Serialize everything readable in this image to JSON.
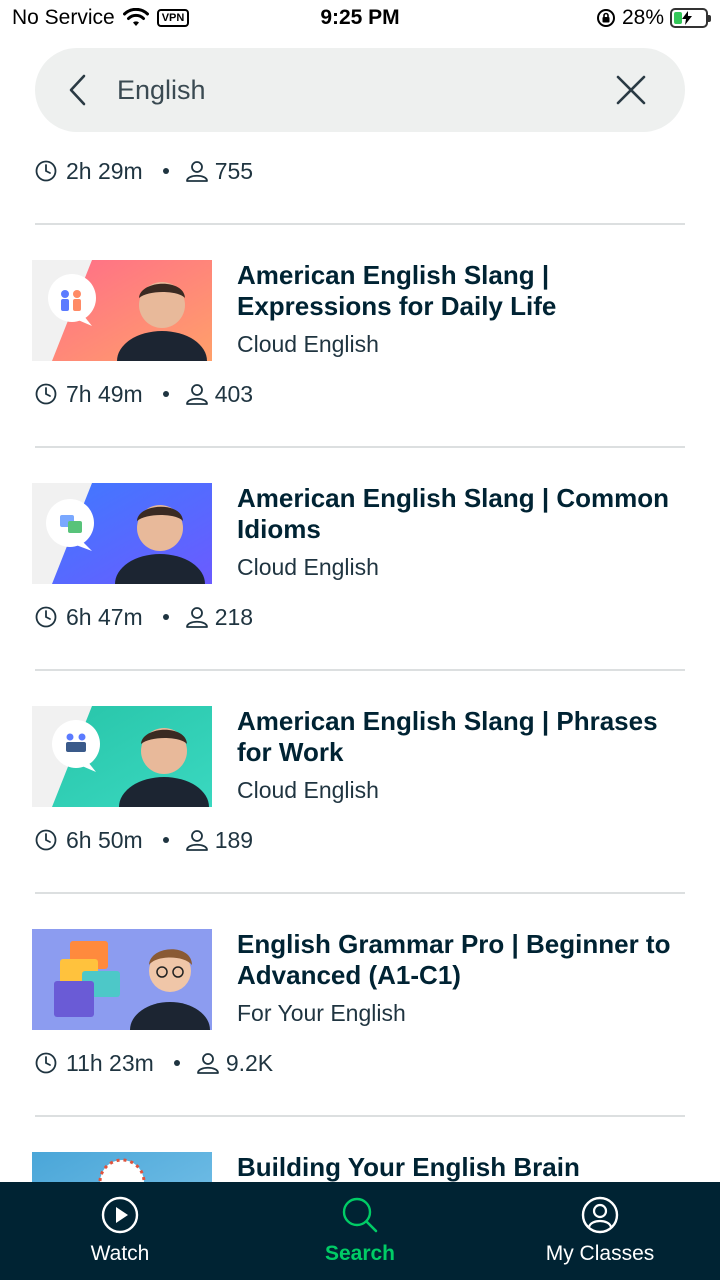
{
  "status_bar": {
    "carrier": "No Service",
    "vpn": "VPN",
    "time": "9:25 PM",
    "battery": "28%",
    "battery_level": 0.28
  },
  "search": {
    "query": "English"
  },
  "results": [
    {
      "duration": "2h 29m",
      "students": "755"
    },
    {
      "title": "American English Slang | Expressions for Daily Life",
      "author": "Cloud English",
      "duration": "7h 49m",
      "students": "403",
      "thumb_colors": [
        "#ff6b8a",
        "#ffa06a"
      ]
    },
    {
      "title": "American English Slang | Common Idioms",
      "author": "Cloud English",
      "duration": "6h 47m",
      "students": "218",
      "thumb_colors": [
        "#3d7bff",
        "#6b5bff"
      ]
    },
    {
      "title": "American English Slang | Phrases for Work",
      "author": "Cloud English",
      "duration": "6h 50m",
      "students": "189",
      "thumb_colors": [
        "#27c4a8",
        "#3ad8c0"
      ]
    },
    {
      "title": "English Grammar Pro | Beginner to Advanced (A1-C1)",
      "author": "For Your English",
      "duration": "11h 23m",
      "students": "9.2K",
      "thumb_colors": [
        "#8c9cf0",
        "#a4b0f5"
      ]
    },
    {
      "title": "Building Your English Brain",
      "thumb_colors": [
        "#4aa6d8",
        "#7cc4ea"
      ]
    }
  ],
  "nav": {
    "watch": "Watch",
    "search": "Search",
    "my_classes": "My Classes"
  },
  "colors": {
    "accent": "#00cc66",
    "nav_bg": "#002333",
    "text": "#002333"
  }
}
